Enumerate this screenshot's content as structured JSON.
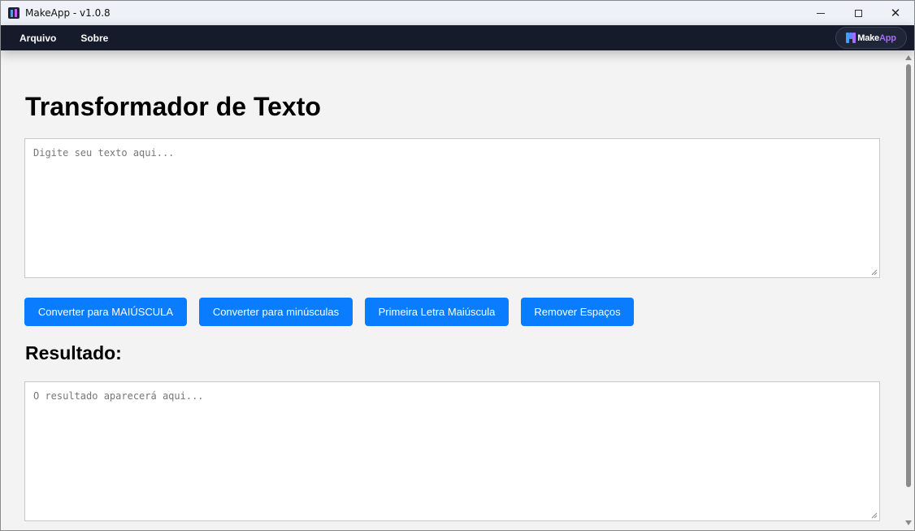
{
  "window": {
    "title": "MakeApp - v1.0.8",
    "controls": {
      "minimize_icon": "minimize-icon",
      "maximize_icon": "maximize-icon",
      "close_icon": "close-icon",
      "close_glyph": "✕"
    }
  },
  "menu": {
    "items": [
      {
        "label": "Arquivo"
      },
      {
        "label": "Sobre"
      }
    ],
    "brand": {
      "part1": "Make",
      "part2": "App"
    }
  },
  "main": {
    "title": "Transformador de Texto",
    "input": {
      "value": "",
      "placeholder": "Digite seu texto aqui..."
    },
    "buttons": [
      {
        "label": "Converter para MAIÚSCULA"
      },
      {
        "label": "Converter para minúsculas"
      },
      {
        "label": "Primeira Letra Maiúscula"
      },
      {
        "label": "Remover Espaços"
      }
    ],
    "result_title": "Resultado:",
    "output": {
      "value": "",
      "placeholder": "O resultado aparecerá aqui..."
    }
  },
  "colors": {
    "accent": "#0a7cff",
    "menubar": "#151b2b",
    "brand_purple": "#a86bff",
    "brand_blue": "#3fa0ff"
  }
}
